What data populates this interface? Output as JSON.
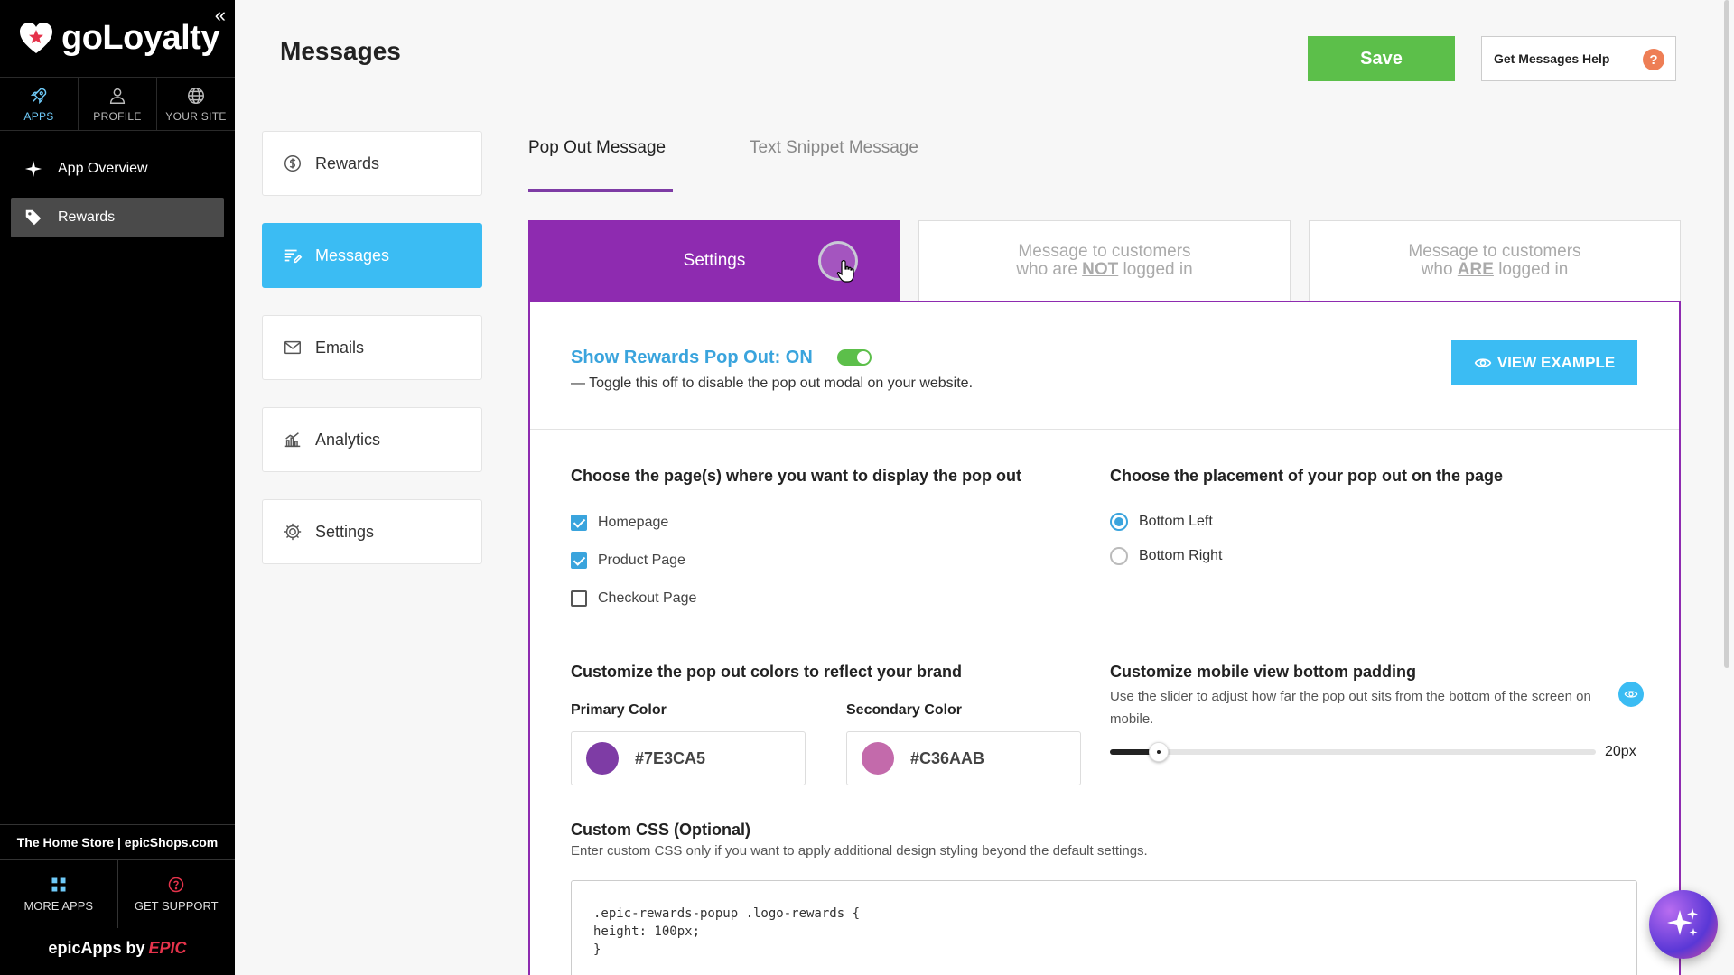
{
  "brand": {
    "name": "goLoyalty",
    "collapse_icon": "«"
  },
  "topnav": [
    {
      "label": "APPS",
      "icon": "rocket-icon"
    },
    {
      "label": "PROFILE",
      "icon": "user-icon"
    },
    {
      "label": "YOUR SITE",
      "icon": "globe-icon"
    }
  ],
  "menu": [
    {
      "label": "App Overview",
      "icon": "sparkle-icon"
    },
    {
      "label": "Rewards",
      "icon": "tag-icon"
    }
  ],
  "store": "The Home Store | epicShops.com",
  "bottomnav": [
    {
      "label": "MORE APPS",
      "icon": "grid-icon"
    },
    {
      "label": "GET SUPPORT",
      "icon": "help-circle-icon"
    }
  ],
  "footer": {
    "prefix": "epicApps by",
    "brand": "EPIC"
  },
  "header": {
    "title": "Messages",
    "save": "Save",
    "help": "Get Messages Help",
    "help_mark": "?"
  },
  "subnav": [
    {
      "label": "Rewards",
      "icon": "dollar-circle-icon"
    },
    {
      "label": "Messages",
      "icon": "message-lines-icon"
    },
    {
      "label": "Emails",
      "icon": "envelope-icon"
    },
    {
      "label": "Analytics",
      "icon": "chart-icon"
    },
    {
      "label": "Settings",
      "icon": "gear-icon"
    }
  ],
  "tabs": {
    "pop_out": "Pop Out Message",
    "text_snippet": "Text Snippet Message"
  },
  "panel_tabs": {
    "settings": "Settings",
    "not_logged": {
      "line1": "Message to customers",
      "pre": "who are ",
      "em": "NOT",
      "post": " logged in"
    },
    "logged": {
      "line1": "Message to customers",
      "pre": "who ",
      "em": "ARE",
      "post": " logged in"
    }
  },
  "popout": {
    "title": "Show Rewards Pop Out: ON",
    "desc": "— Toggle this off to disable the pop out modal on your website.",
    "view_example": "VIEW EXAMPLE",
    "enabled": true
  },
  "pages": {
    "title": "Choose the page(s) where you want to display the pop out",
    "options": [
      {
        "label": "Homepage",
        "checked": true
      },
      {
        "label": "Product Page",
        "checked": true
      },
      {
        "label": "Checkout Page",
        "checked": false
      }
    ]
  },
  "placement": {
    "title": "Choose the placement of your pop out on the page",
    "options": [
      {
        "label": "Bottom Left",
        "selected": true
      },
      {
        "label": "Bottom Right",
        "selected": false
      }
    ]
  },
  "colors": {
    "title": "Customize the pop out colors to reflect your brand",
    "primary_label": "Primary Color",
    "primary": "#7E3CA5",
    "secondary_label": "Secondary Color",
    "secondary": "#C36AAB"
  },
  "mobile": {
    "title": "Customize mobile view bottom padding",
    "desc": "Use the slider to adjust how far the pop out sits from the bottom of the screen on mobile.",
    "value": "20px",
    "slider_fraction": 0.08
  },
  "custom_css": {
    "title": "Custom CSS (Optional)",
    "desc": "Enter custom CSS only if you want to apply additional design styling beyond the default settings.",
    "code": ".epic-rewards-popup .logo-rewards {\nheight: 100px;\n}"
  },
  "accent_colors": {
    "purple": "#8e2bb0",
    "blue": "#3bbcf3",
    "green": "#5cbf4a"
  }
}
